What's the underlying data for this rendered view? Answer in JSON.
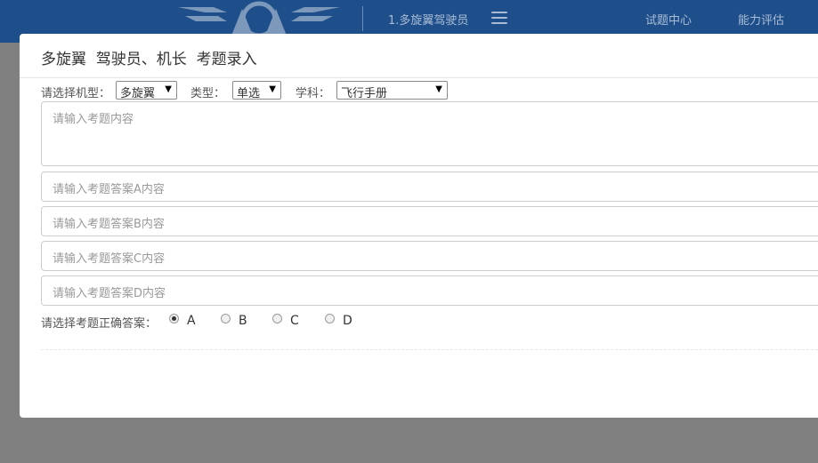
{
  "topbar": {
    "nav_title": "1.多旋翼驾驶员",
    "links": [
      "试题中心",
      "能力评估"
    ]
  },
  "modal": {
    "title": "多旋翼  驾驶员、机长  考题录入"
  },
  "filters": {
    "aircraft_label": "请选择机型：",
    "aircraft_value": "多旋翼",
    "type_label": "类型：",
    "type_value": "单选",
    "subject_label": "学科：",
    "subject_value": "飞行手册"
  },
  "fields": {
    "question_placeholder": "请输入考题内容",
    "answer_a_placeholder": "请输入考题答案A内容",
    "answer_b_placeholder": "请输入考题答案B内容",
    "answer_c_placeholder": "请输入考题答案C内容",
    "answer_d_placeholder": "请输入考题答案D内容"
  },
  "correct_answer": {
    "label": "请选择考题正确答案：",
    "options": [
      "A",
      "B",
      "C",
      "D"
    ],
    "selected": "A"
  },
  "colors": {
    "topbar": "#1f4f8a",
    "overlay": "#808080"
  }
}
